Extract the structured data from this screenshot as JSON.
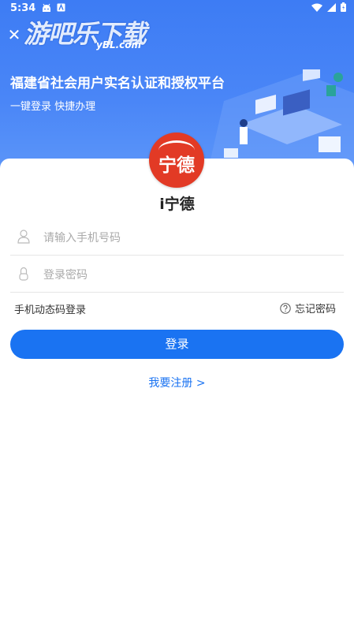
{
  "status_bar": {
    "time": "5:34"
  },
  "watermark": {
    "text": "游吧乐下载",
    "sub": "yBL.com"
  },
  "header": {
    "title": "福建省社会用户实名认证和授权平台",
    "subtitle": "一键登录 快捷办理"
  },
  "app": {
    "logo_text": "宁德",
    "name": "i宁德"
  },
  "form": {
    "phone_placeholder": "请输入手机号码",
    "password_placeholder": "登录密码",
    "sms_login_label": "手机动态码登录",
    "forgot_label": "忘记密码",
    "login_label": "登录",
    "register_label": "我要注册 >"
  },
  "colors": {
    "header_blue": "#4a86f7",
    "accent": "#1a73f2",
    "logo_red": "#e23a25"
  }
}
